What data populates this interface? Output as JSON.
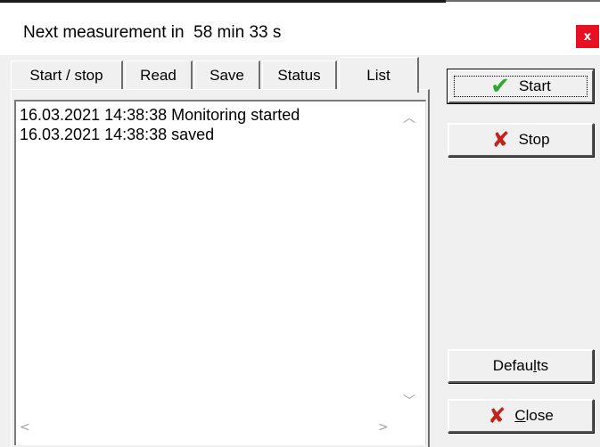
{
  "title": {
    "label": "Next measurement in  58 min 33 s",
    "close_glyph": "x"
  },
  "tabs": [
    {
      "label": "Start / stop",
      "active": false
    },
    {
      "label": "Read",
      "active": false
    },
    {
      "label": "Save",
      "active": false
    },
    {
      "label": "Status",
      "active": false
    },
    {
      "label": "List",
      "active": true
    }
  ],
  "log": {
    "lines": [
      "16.03.2021 14:38:38 Monitoring started",
      "16.03.2021 14:38:38 saved"
    ]
  },
  "buttons": {
    "start": {
      "label": "Start",
      "icon": "check-icon"
    },
    "stop": {
      "label": "Stop",
      "icon": "x-icon"
    },
    "defaults": {
      "label_pre": "Defau",
      "label_accel": "l",
      "label_post": "ts"
    },
    "close": {
      "label_accel": "C",
      "label_post": "lose",
      "icon": "x-icon"
    }
  },
  "colors": {
    "close_bg": "#e81123",
    "check": "#2ea82e",
    "xmark": "#c0241b"
  }
}
